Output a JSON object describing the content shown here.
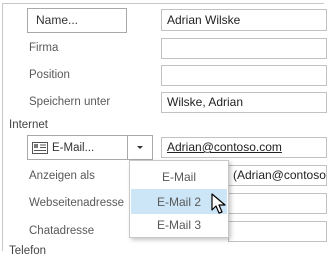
{
  "form": {
    "name_button_label": "Name...",
    "name_value": "Adrian Wilske",
    "firma_label": "Firma",
    "firma_value": "",
    "position_label": "Position",
    "position_value": "",
    "speichern_label": "Speichern unter",
    "speichern_value": "Wilske, Adrian",
    "internet_label": "Internet",
    "email_button_label": "E-Mail...",
    "email_value": "Adrian@contoso.com",
    "anzeigen_label": "Anzeigen als",
    "anzeigen_value": "(Adrian@contoso.",
    "webseite_label": "Webseitenadresse",
    "webseite_value": "",
    "chat_label": "Chatadresse",
    "chat_value": "",
    "telefon_label": "Telefon"
  },
  "dropdown": {
    "items": [
      "E-Mail",
      "E-Mail 2",
      "E-Mail 3"
    ],
    "highlighted": "E-Mail 2"
  },
  "colors": {
    "highlight": "#cde6f7",
    "border": "#c2c2c2"
  },
  "icons": {
    "email_icon": "address-card-icon",
    "dropdown_arrow": "chevron-down-icon",
    "cursor": "mouse-pointer-icon"
  }
}
